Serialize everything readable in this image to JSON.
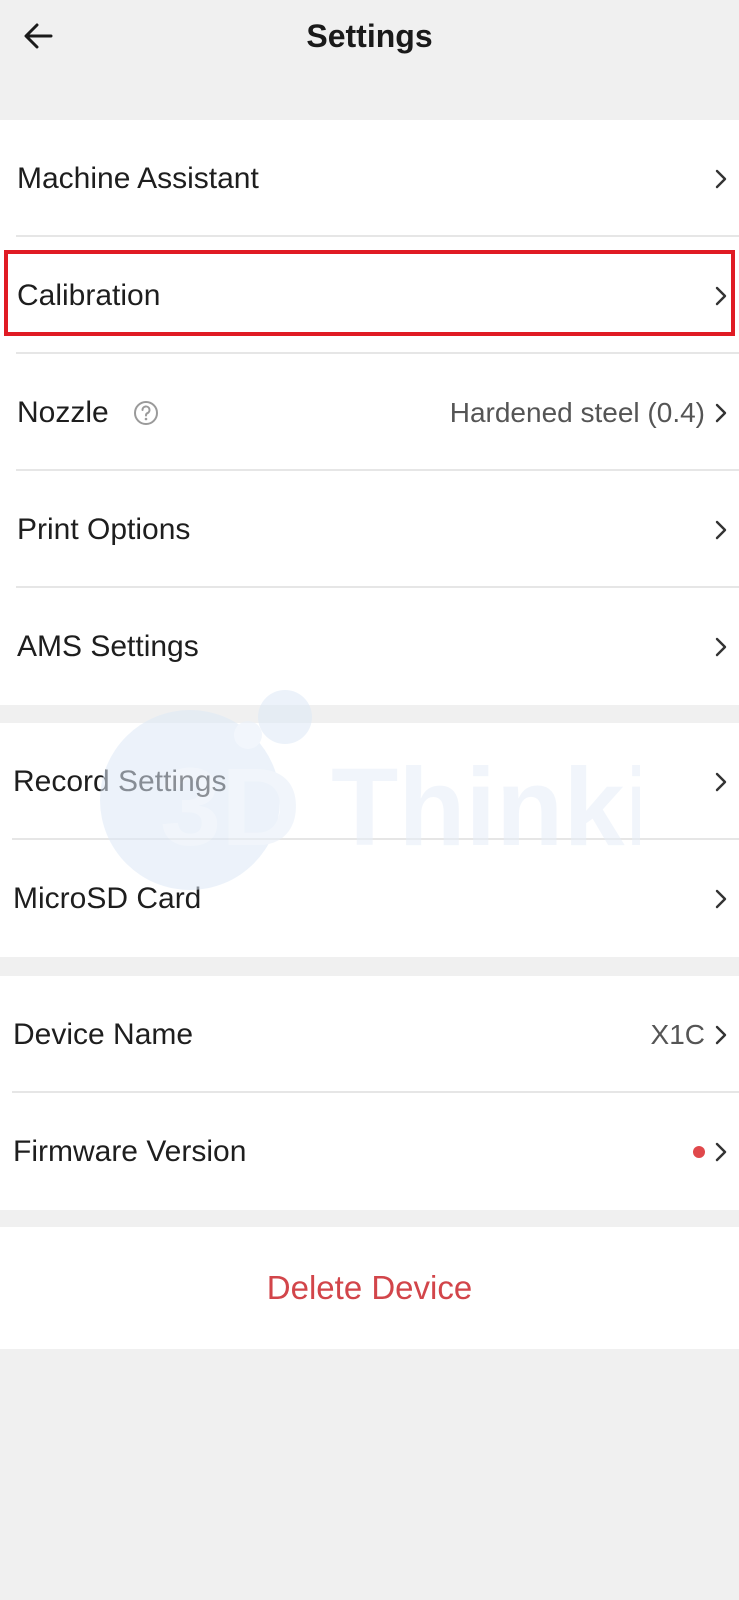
{
  "header": {
    "title": "Settings",
    "back_icon": "arrow-left-icon"
  },
  "group1": {
    "items": [
      {
        "label": "Machine Assistant"
      },
      {
        "label": "Calibration",
        "highlighted": true
      },
      {
        "label": "Nozzle",
        "value": "Hardened steel (0.4)",
        "help_icon": "question-circle-icon"
      },
      {
        "label": "Print Options"
      },
      {
        "label": "AMS Settings"
      }
    ]
  },
  "group2": {
    "items": [
      {
        "label": "Record Settings"
      },
      {
        "label": "MicroSD Card"
      }
    ]
  },
  "group3": {
    "items": [
      {
        "label": "Device Name",
        "value": "X1C"
      },
      {
        "label": "Firmware Version",
        "badge": "red-dot"
      }
    ]
  },
  "delete": {
    "label": "Delete Device"
  },
  "watermark": {
    "text": "3D Thinking"
  },
  "colors": {
    "background": "#f0f0f0",
    "card": "#ffffff",
    "highlight": "#e01b24",
    "danger": "#d2454a",
    "badge": "#e0484b",
    "watermark": "#dde9f7"
  }
}
